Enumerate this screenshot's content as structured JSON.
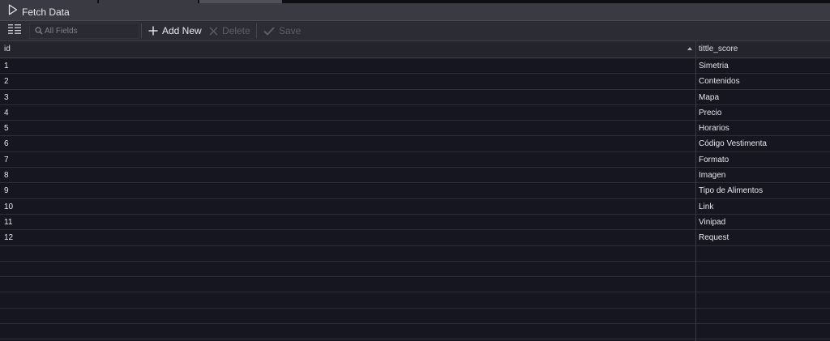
{
  "fetch": {
    "label": "Fetch Data"
  },
  "toolbar": {
    "search_placeholder": "All Fields",
    "add_label": "Add New",
    "delete_label": "Delete",
    "save_label": "Save"
  },
  "table": {
    "columns": [
      "id",
      "tittle_score"
    ],
    "sort_column": "id",
    "rows": [
      [
        "1",
        "Simetria"
      ],
      [
        "2",
        "Contenidos"
      ],
      [
        "3",
        "Mapa"
      ],
      [
        "4",
        "Precio"
      ],
      [
        "5",
        "Horarios"
      ],
      [
        "6",
        "Código Vestimenta"
      ],
      [
        "7",
        "Formato"
      ],
      [
        "8",
        "Imagen"
      ],
      [
        "9",
        "Tipo de Alimentos"
      ],
      [
        "10",
        "Link"
      ],
      [
        "11",
        "Vinipad"
      ],
      [
        "12",
        "Request"
      ]
    ]
  },
  "colors": {
    "background": "#161620",
    "toolbar": "#2c2c34",
    "header": "#24242c",
    "disabled_text": "#5e5e66"
  }
}
